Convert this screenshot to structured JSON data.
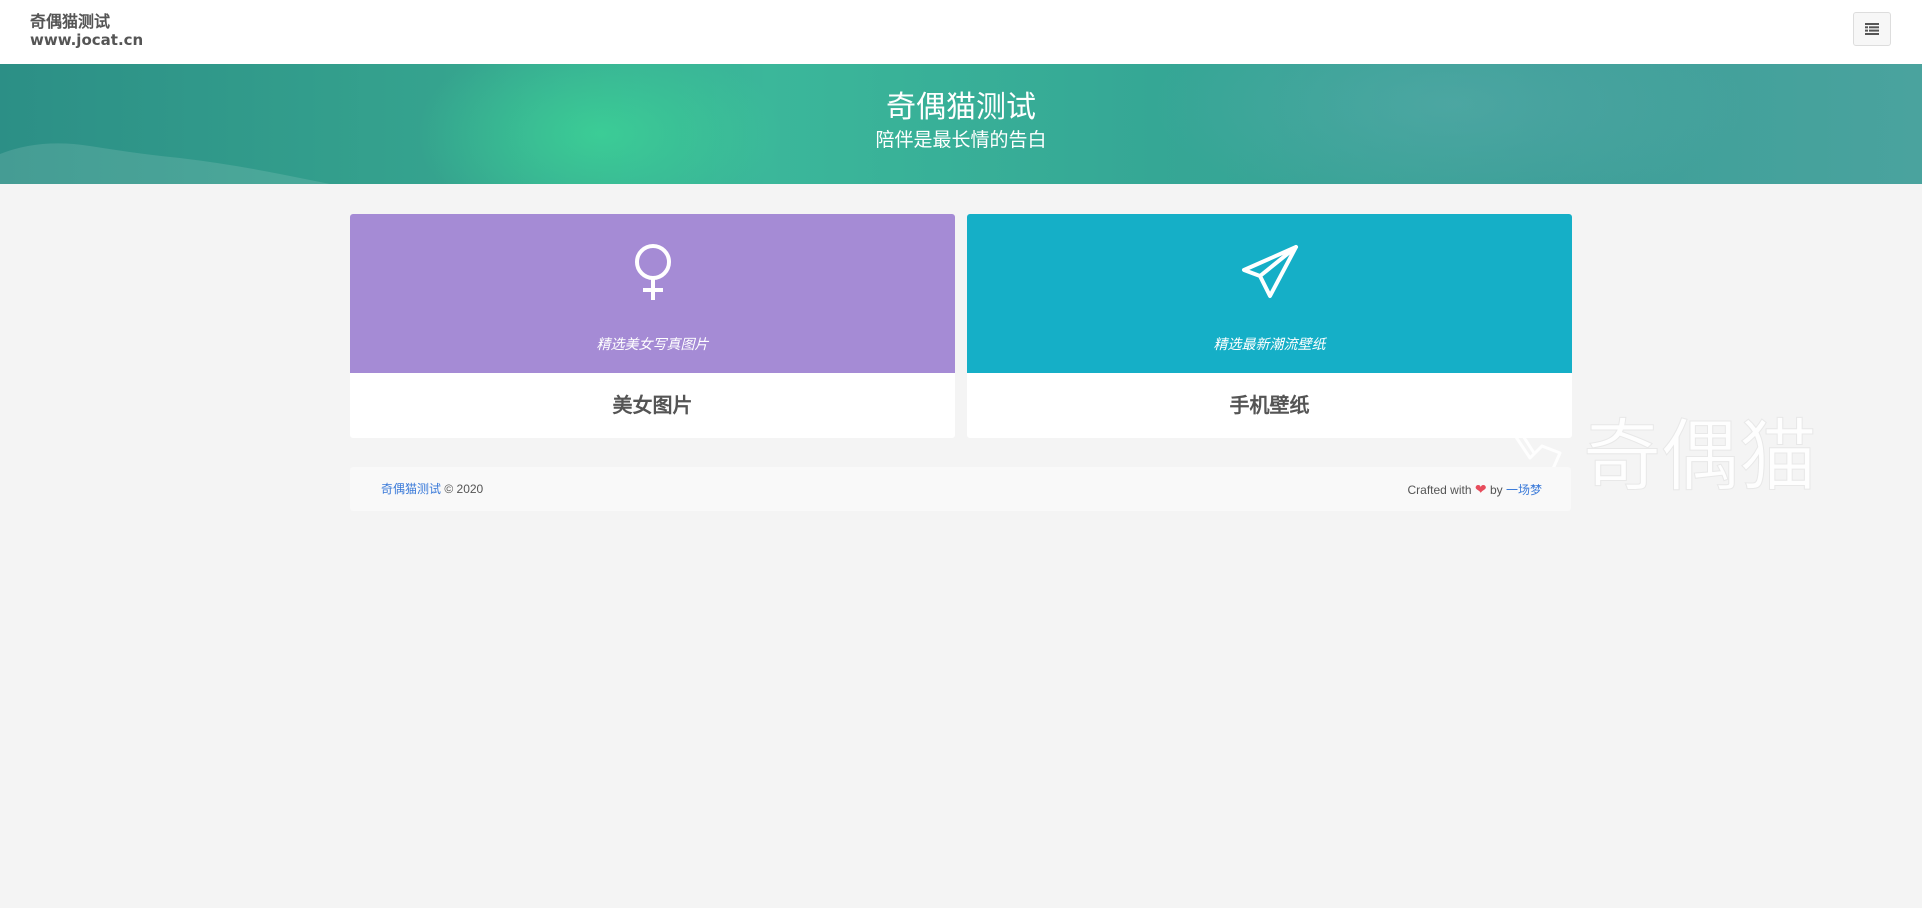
{
  "header": {
    "site_name": "奇偶猫测试",
    "site_url": "www.jocat.cn",
    "menu_icon": "menu-list-icon"
  },
  "hero": {
    "title": "奇偶猫测试",
    "subtitle": "陪伴是最长情的告白"
  },
  "cards": [
    {
      "icon": "venus-female-icon",
      "description": "精选美女写真图片",
      "title": "美女图片",
      "color": "#a58bd5"
    },
    {
      "icon": "paper-plane-icon",
      "description": "精选最新潮流壁纸",
      "title": "手机壁纸",
      "color": "#15afc7"
    }
  ],
  "watermark": {
    "text": "奇偶猫"
  },
  "footer": {
    "site_link": "奇偶猫测试",
    "copyright": "© 2020",
    "crafted_with": "Crafted with",
    "heart": "❤",
    "by": "by",
    "author_link": "一场梦"
  }
}
